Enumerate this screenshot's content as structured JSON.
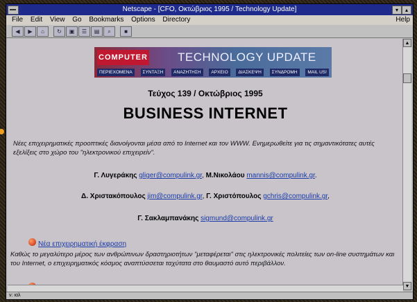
{
  "window": {
    "title": "Netscape - [CFO, Οκτώβριος 1995 / Technology Update]"
  },
  "menu": [
    "File",
    "Edit",
    "View",
    "Go",
    "Bookmarks",
    "Options",
    "Directory"
  ],
  "menu_help": "Help",
  "toolbar_icons": [
    "back-icon",
    "forward-icon",
    "home-icon",
    "reload-icon",
    "images-icon",
    "open-icon",
    "print-icon",
    "find-icon",
    "stop-icon"
  ],
  "banner": {
    "logo": "COMPUTER",
    "title": "TECHNOLOGY UPDATE",
    "nav": [
      "ΠΕΡΙΕΧΟΜΕΝΑ",
      "ΣΥΝΤΑΞΗ",
      "ΑΝΑΖΗΤΗΣΗ",
      "ΑΡΧΕΙΟ",
      "ΔΙΑΣΚΕΨΗ",
      "ΣΥΝΔΡΟΜΗ",
      "MAIL US!"
    ]
  },
  "issue": "Τεύχος 139 / Οκτώβριος 1995",
  "headline": "BUSINESS INTERNET",
  "intro": "Νέες επιχειρηματικές προοπτικές διανοίγονται μέσα από το Internet και τον WWW. Ενημερωθείτε για τις σημαντικότατες αυτές εξελίξεις στο χώρο του \"ηλεκτρονικού επιχειρείν\".",
  "authors": [
    {
      "name1": "Γ. Λυγεράκης",
      "email1": "gliger@compulink.gr",
      "sep": ",",
      "name2": "Μ.Νικολάου",
      "email2": "mannis@compulink.gr",
      "end": "."
    },
    {
      "name1": "Δ. Χριστακόπουλος",
      "email1": "jim@compulink.gr",
      "sep": ",",
      "name2": "Γ. Χριστόπουλος",
      "email2": "gchris@compulink.gr",
      "end": ","
    },
    {
      "name1": "Γ. Σακλαμπανάκης",
      "email1": "sigmund@compulink.gr",
      "sep": "",
      "name2": "",
      "email2": "",
      "end": ""
    }
  ],
  "section": {
    "link": "Νέα επιχειρηματική έκφραση",
    "body": "Καθώς το μεγαλύτερο μέρος των ανθρώπινων δραστηριοτήτων \"μεταφέρεται\" στις ηλεκτρονικές πολιτείες των on-line συστημάτων και του Internet, ο επιχειρηματικός κόσμος αναπτύσσεται ταχύτατα στο θαυμαστό αυτό περιβάλλον."
  },
  "status": "ν:  ιαλ"
}
